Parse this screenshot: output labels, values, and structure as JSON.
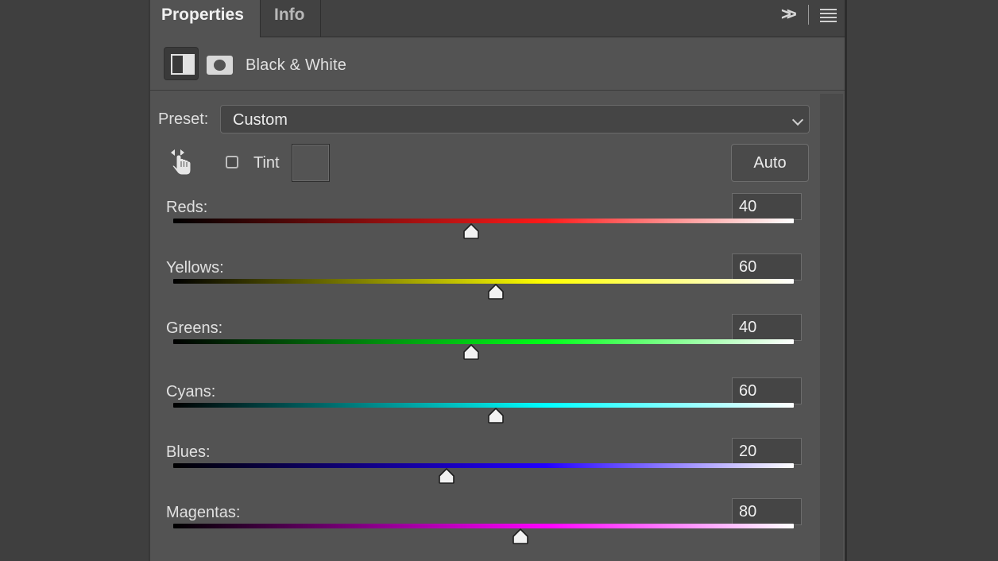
{
  "tabs": [
    {
      "label": "Properties",
      "active": true
    },
    {
      "label": "Info",
      "active": false
    }
  ],
  "toolbar": {
    "collapse_icon": "double-chevron-right-icon",
    "menu_icon": "hamburger-menu-icon",
    "collapse_glyph": ">>"
  },
  "header": {
    "title": "Black & White",
    "adjustment_icon": "adjustment-layer-icon",
    "mask_icon": "layer-mask-icon"
  },
  "preset": {
    "label": "Preset:",
    "value": "Custom"
  },
  "tools": {
    "targeted_adjust_icon": "hand-targeted-adjustment-icon",
    "tint_label": "Tint",
    "tint_checked": false,
    "auto_label": "Auto"
  },
  "sliders": [
    {
      "label": "Reds:",
      "value": "40",
      "level": 40,
      "color": "#ff1a1a"
    },
    {
      "label": "Yellows:",
      "value": "60",
      "level": 60,
      "color": "#ffff00"
    },
    {
      "label": "Greens:",
      "value": "40",
      "level": 40,
      "color": "#00ff1a"
    },
    {
      "label": "Cyans:",
      "value": "60",
      "level": 60,
      "color": "#00ffff"
    },
    {
      "label": "Blues:",
      "value": "20",
      "level": 20,
      "color": "#2200ff"
    },
    {
      "label": "Magentas:",
      "value": "80",
      "level": 80,
      "color": "#ff00ff"
    }
  ],
  "slider_range": {
    "min": -200,
    "max": 300
  }
}
